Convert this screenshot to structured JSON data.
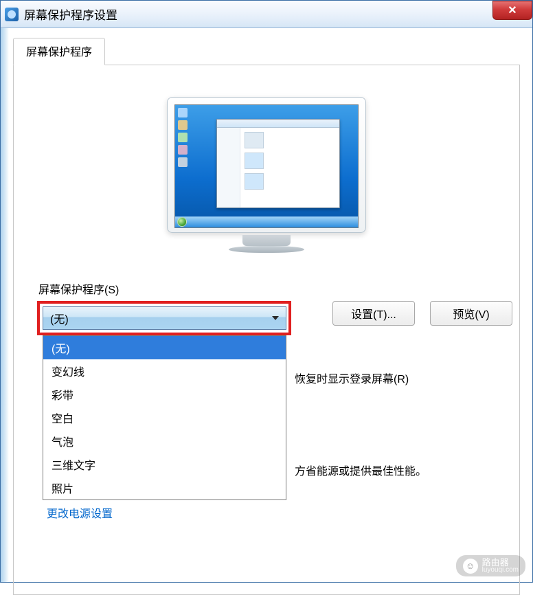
{
  "window": {
    "title": "屏幕保护程序设置"
  },
  "tab": {
    "label": "屏幕保护程序"
  },
  "group": {
    "label": "屏幕保护程序(S)"
  },
  "combo": {
    "selected": "(无)"
  },
  "dropdown": {
    "items": [
      "(无)",
      "变幻线",
      "彩带",
      "空白",
      "气泡",
      "三维文字",
      "照片"
    ]
  },
  "buttons": {
    "settings": "设置(T)...",
    "preview": "预览(V)"
  },
  "resume_text": "恢复时显示登录屏幕(R)",
  "perf_text": "方省能源或提供最佳性能。",
  "power_link": "更改电源设置",
  "watermark": {
    "main": "路由器",
    "sub": "luyouqi.com"
  }
}
